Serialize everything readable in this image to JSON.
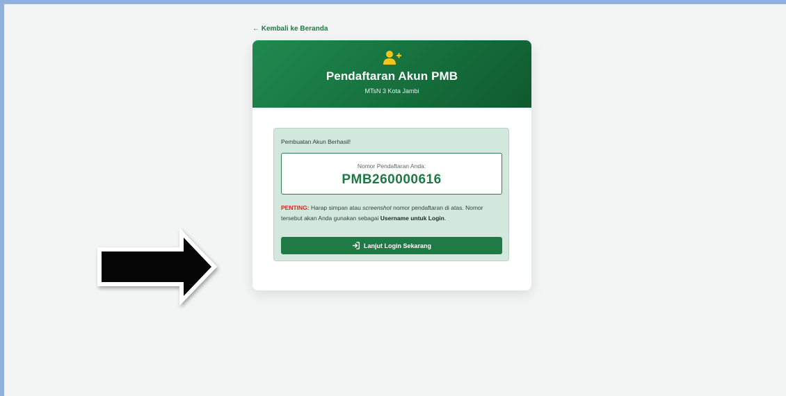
{
  "nav": {
    "back_link": "← Kembali ke Beranda"
  },
  "card": {
    "title": "Pendaftaran Akun PMB",
    "subtitle": "MTsN 3 Kota Jambi",
    "header_icon": "user-plus-icon"
  },
  "alert": {
    "title": "Pembuatan Akun Berhasil!",
    "number_label": "Nomor Pendaftaran Anda:",
    "number_value": "PMB260000616",
    "notice_prefix": "PENTING:",
    "notice_part1": " Harap simpan atau ",
    "notice_italic": "screenshot",
    "notice_part2": " nomor pendaftaran di atas. Nomor tersebut akan Anda gunakan sebagai ",
    "notice_bold": "Username untuk Login",
    "notice_end": ".",
    "button_label": "Lanjut Login Sekarang",
    "button_icon": "sign-in-icon"
  },
  "annotation": {
    "icon": "arrow-right-icon"
  },
  "colors": {
    "primary": "#1f7a46",
    "header_dark": "#0f5a30",
    "icon_accent": "#f5c518",
    "important": "#d22b2b",
    "alert_bg": "#d2e8dc",
    "page_bg": "#f2f5f4",
    "frame": "#8fb2dd"
  }
}
